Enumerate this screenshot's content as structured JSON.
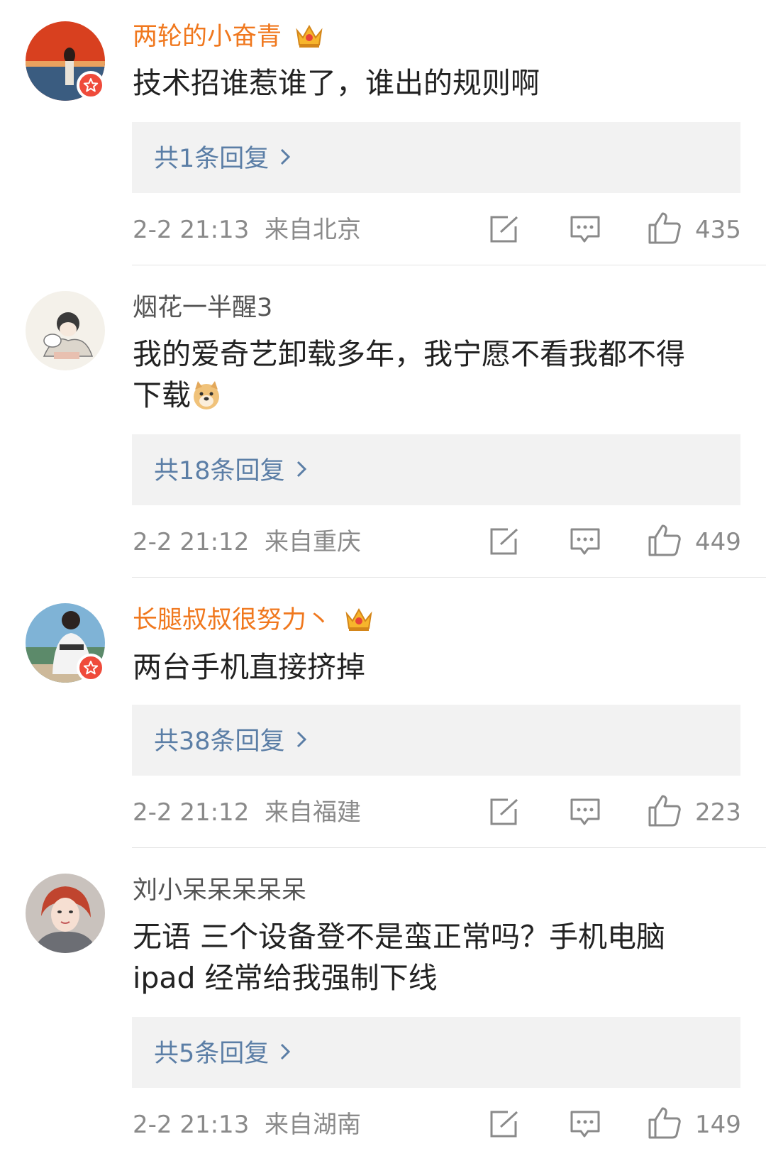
{
  "comments": [
    {
      "username": "两轮的小奋青",
      "vip": true,
      "verified": true,
      "text": "技术招谁惹谁了，谁出的规则啊",
      "replies_label": "共1条回复",
      "time": "2-2 21:13",
      "location": "来自北京",
      "likes": "435"
    },
    {
      "username": "烟花一半醒3",
      "vip": false,
      "verified": false,
      "text_line1": "我的爱奇艺卸载多年，我宁愿不看我都不得",
      "text_line2": "下载",
      "emoji": "doge-emoji",
      "replies_label": "共18条回复",
      "time": "2-2 21:12",
      "location": "来自重庆",
      "likes": "449"
    },
    {
      "username": "长腿叔叔很努力丶",
      "vip": true,
      "verified": true,
      "text": "两台手机直接挤掉",
      "replies_label": "共38条回复",
      "time": "2-2 21:12",
      "location": "来自福建",
      "likes": "223"
    },
    {
      "username": "刘小呆呆呆呆呆",
      "vip": false,
      "verified": false,
      "text_line1": "无语 三个设备登不是蛮正常吗？手机电脑",
      "text_line2": "ipad 经常给我强制下线",
      "replies_label": "共5条回复",
      "time": "2-2 21:13",
      "location": "来自湖南",
      "likes": "149"
    }
  ],
  "icons": {
    "share": "share-icon",
    "comment": "comment-icon",
    "like": "thumbs-up-icon",
    "crown": "crown-icon",
    "verified": "verified-star-icon",
    "chevron": "chevron-right-icon"
  },
  "colors": {
    "vip_name": "#f0781e",
    "name": "#555555",
    "text": "#222222",
    "reply_link": "#5b7ea6",
    "reply_bg": "#f2f2f2",
    "meta": "#8a8a8a",
    "verified_badge": "#ef4b3b"
  }
}
